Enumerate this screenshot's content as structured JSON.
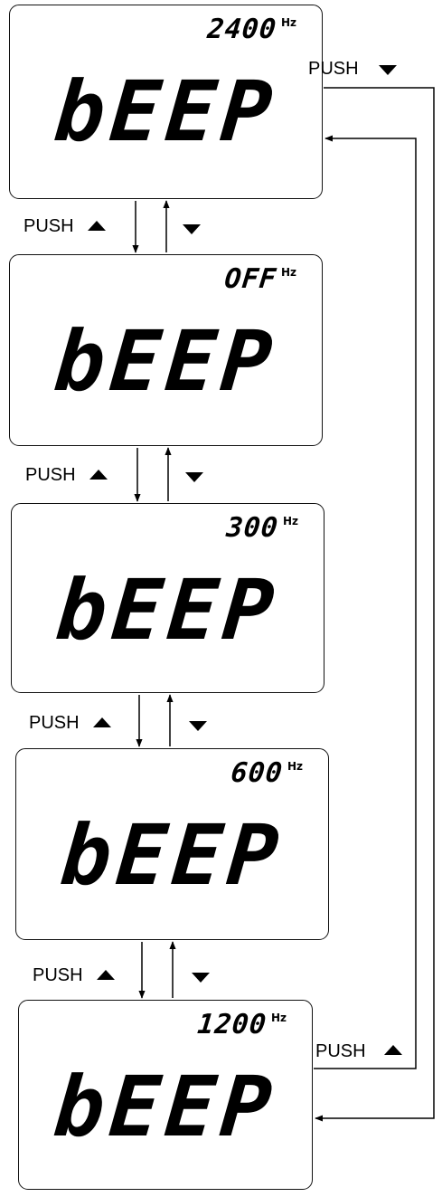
{
  "panels": [
    {
      "frequency": "2400",
      "unit": "Hz",
      "display": "bEEP"
    },
    {
      "frequency": "OFF",
      "unit": "Hz",
      "display": "bEEP"
    },
    {
      "frequency": "300",
      "unit": "Hz",
      "display": "bEEP"
    },
    {
      "frequency": "600",
      "unit": "Hz",
      "display": "bEEP"
    },
    {
      "frequency": "1200",
      "unit": "Hz",
      "display": "bEEP"
    }
  ],
  "transitions": [
    {
      "up_label": "PUSH",
      "up_key": "up-arrow",
      "down_key": "down-arrow"
    },
    {
      "up_label": "PUSH",
      "up_key": "up-arrow",
      "down_key": "down-arrow"
    },
    {
      "up_label": "PUSH",
      "up_key": "up-arrow",
      "down_key": "down-arrow"
    },
    {
      "up_label": "PUSH",
      "up_key": "up-arrow",
      "down_key": "down-arrow"
    }
  ],
  "wrap": {
    "top_label": "PUSH",
    "top_key": "down-arrow",
    "bottom_label": "PUSH",
    "bottom_key": "up-arrow"
  }
}
